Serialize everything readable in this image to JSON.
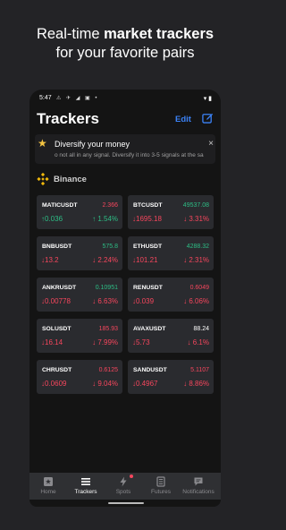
{
  "promo": {
    "line1_pre": "Real-time ",
    "line1_bold": "market trackers",
    "line2": "for your favorite pairs"
  },
  "statusbar": {
    "time": "5:47",
    "notif_icons": "⚠ ✈ ◢ ▣ •",
    "right_icons": "▾ ▮"
  },
  "header": {
    "title": "Trackers",
    "edit_label": "Edit",
    "new_icon": "edit-square-icon"
  },
  "banner": {
    "title": "Diversify your money",
    "text": "o not all in any signal. Diversify it into 3-5 signals at the sa",
    "close": "×"
  },
  "exchange": {
    "name": "Binance"
  },
  "colors": {
    "up": "#2dbd85",
    "down": "#f6465d",
    "accent": "#3b82f6"
  },
  "trackers": [
    {
      "symbol": "MATICUSDT",
      "price": "2.366",
      "price_dir": "down",
      "change": "↑0.036",
      "percent": "↑ 1.54%",
      "dir": "up"
    },
    {
      "symbol": "BTCUSDT",
      "price": "49537.08",
      "price_dir": "up",
      "change": "↓1695.18",
      "percent": "↓ 3.31%",
      "dir": "down"
    },
    {
      "symbol": "BNBUSDT",
      "price": "575.8",
      "price_dir": "up",
      "change": "↓13.2",
      "percent": "↓ 2.24%",
      "dir": "down"
    },
    {
      "symbol": "ETHUSDT",
      "price": "4288.32",
      "price_dir": "up",
      "change": "↓101.21",
      "percent": "↓ 2.31%",
      "dir": "down"
    },
    {
      "symbol": "ANKRUSDT",
      "price": "0.10951",
      "price_dir": "up",
      "change": "↓0.00778",
      "percent": "↓ 6.63%",
      "dir": "down"
    },
    {
      "symbol": "RENUSDT",
      "price": "0.6049",
      "price_dir": "down",
      "change": "↓0.039",
      "percent": "↓ 6.06%",
      "dir": "down"
    },
    {
      "symbol": "SOLUSDT",
      "price": "185.93",
      "price_dir": "down",
      "change": "↓16.14",
      "percent": "↓ 7.99%",
      "dir": "down"
    },
    {
      "symbol": "AVAXUSDT",
      "price": "88.24",
      "price_dir": "neutral",
      "change": "↓5.73",
      "percent": "↓ 6.1%",
      "dir": "down"
    },
    {
      "symbol": "CHRUSDT",
      "price": "0.6125",
      "price_dir": "down",
      "change": "↓0.0609",
      "percent": "↓ 9.04%",
      "dir": "down"
    },
    {
      "symbol": "SANDUSDT",
      "price": "5.1107",
      "price_dir": "down",
      "change": "↓0.4967",
      "percent": "↓ 8.86%",
      "dir": "down"
    }
  ],
  "tabs": [
    {
      "label": "Home",
      "icon": "home-icon",
      "active": false,
      "dot": false
    },
    {
      "label": "Trackers",
      "icon": "trackers-icon",
      "active": true,
      "dot": false
    },
    {
      "label": "Spots",
      "icon": "spots-icon",
      "active": false,
      "dot": true
    },
    {
      "label": "Futures",
      "icon": "futures-icon",
      "active": false,
      "dot": false
    },
    {
      "label": "Notifications",
      "icon": "notifications-icon",
      "active": false,
      "dot": false
    }
  ]
}
